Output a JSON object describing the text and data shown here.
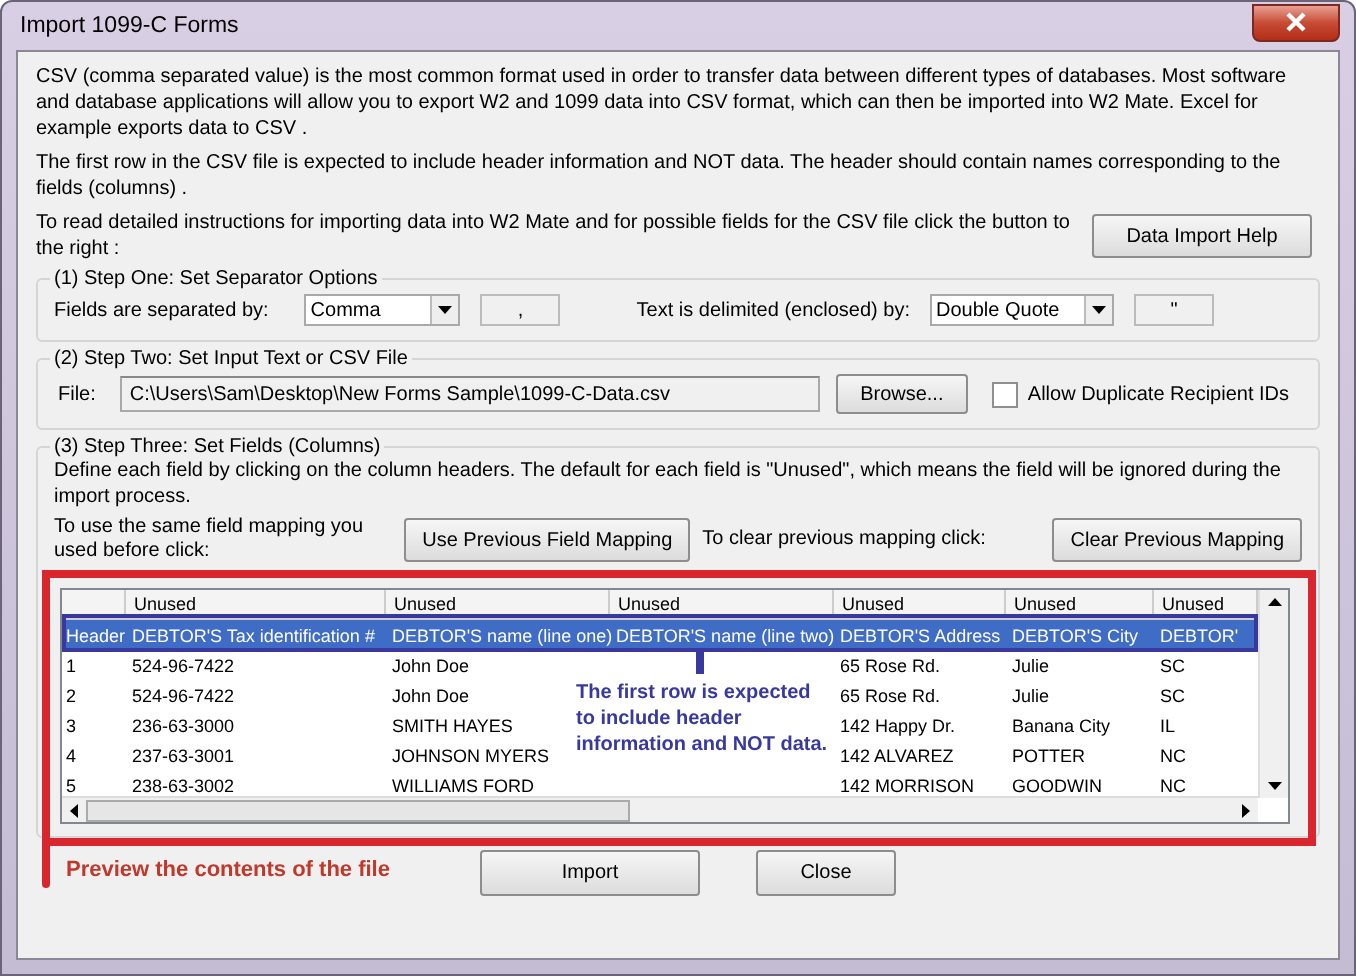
{
  "window": {
    "title": "Import 1099-C Forms"
  },
  "intro": [
    "CSV (comma separated value) is the most common format used in order to transfer data between different types of databases.  Most software and database applications will allow you to export W2 and 1099 data into CSV format, which can then be imported into W2 Mate. Excel for example exports data to CSV .",
    "The first row in the CSV file is expected to include header information and NOT data. The header should contain names corresponding to the fields (columns) ."
  ],
  "help": {
    "text": "To read detailed instructions for importing data into W2 Mate and for possible fields for the CSV file click the button to the right :",
    "button": "Data Import Help"
  },
  "step_one": {
    "title": "(1)  Step One: Set Separator Options",
    "field_label": "Fields are separated by:",
    "field_value": "Comma",
    "field_char": ",",
    "text_label": "Text is delimited (enclosed) by:",
    "text_value": "Double Quote",
    "text_char": "\""
  },
  "step_two": {
    "title": "(2)  Step Two: Set Input Text or CSV File",
    "file_label": "File:",
    "file_value": "C:\\Users\\Sam\\Desktop\\New Forms Sample\\1099-C-Data.csv",
    "browse_button": "Browse...",
    "allow_duplicates": {
      "label": "Allow Duplicate Recipient IDs",
      "checked": false
    }
  },
  "step_three": {
    "title": "(3)  Step Three: Set Fields (Columns)",
    "description": "Define each field by clicking on the column headers. The default for each field is \"Unused\", which means the field will be ignored during the import process.",
    "previous_label": "To use the same field mapping you used before click:",
    "previous_button": "Use Previous Field Mapping",
    "clear_label": "To clear previous mapping click:",
    "clear_button": "Clear Previous Mapping",
    "grid": {
      "columns": [
        "Unused",
        "Unused",
        "Unused",
        "Unused",
        "Unused",
        "Unused"
      ],
      "rows": [
        {
          "row_header": "Header",
          "selected": true,
          "cells": [
            "DEBTOR'S Tax identification #",
            "DEBTOR'S name (line one)",
            "DEBTOR'S name (line two)",
            "DEBTOR'S Address",
            "DEBTOR'S City",
            "DEBTOR'"
          ]
        },
        {
          "row_header": "1",
          "selected": false,
          "cells": [
            "524-96-7422",
            "John Doe",
            null,
            "65 Rose Rd.",
            "Julie",
            "SC"
          ]
        },
        {
          "row_header": "2",
          "selected": false,
          "cells": [
            "524-96-7422",
            "John Doe",
            null,
            "65 Rose Rd.",
            "Julie",
            "SC"
          ]
        },
        {
          "row_header": "3",
          "selected": false,
          "cells": [
            "236-63-3000",
            "SMITH HAYES",
            null,
            "142 Happy Dr.",
            "Banana City",
            "IL"
          ]
        },
        {
          "row_header": "4",
          "selected": false,
          "cells": [
            "237-63-3001",
            "JOHNSON MYERS",
            null,
            "142 ALVAREZ",
            "POTTER",
            "NC"
          ]
        },
        {
          "row_header": "5",
          "selected": false,
          "cells": [
            "238-63-3002",
            "WILLIAMS FORD",
            null,
            "142 MORRISON",
            "GOODWIN",
            "NC"
          ]
        }
      ]
    }
  },
  "annotations": {
    "header_row_callout": "The first row is expected to include header information and NOT data.",
    "preview_callout": "Preview the contents of the file"
  },
  "buttons": [
    "Import",
    "Close"
  ]
}
